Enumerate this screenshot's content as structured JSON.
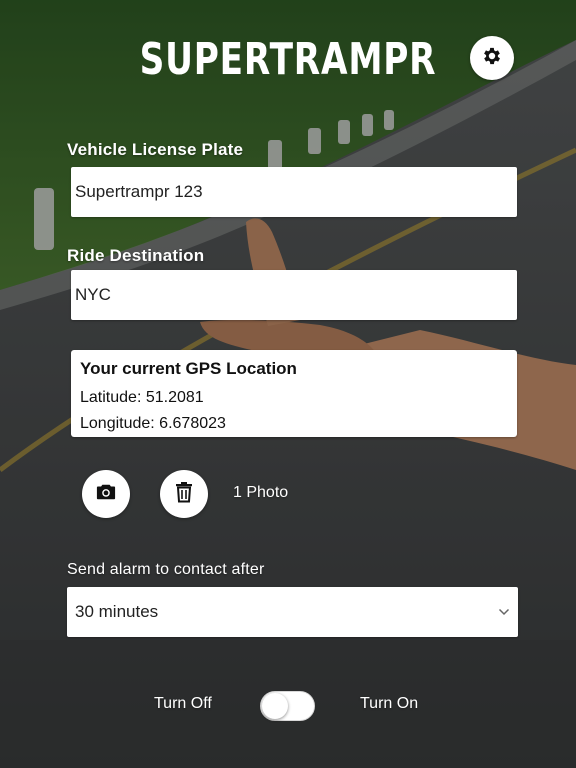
{
  "app": {
    "title": "SUPERTRAMPR"
  },
  "icons": {
    "settings": "gear-icon",
    "camera": "camera-icon",
    "delete": "trash-icon",
    "select_arrow": "chevron-down-icon"
  },
  "form": {
    "plate": {
      "label": "Vehicle License Plate",
      "value": "Supertrampr 123"
    },
    "destination": {
      "label": "Ride Destination",
      "value": "NYC"
    },
    "gps": {
      "title": "Your current GPS Location",
      "latitude_text": "Latitude: 51.2081",
      "longitude_text": "Longitude: 6.678023"
    },
    "photos": {
      "count_text": "1 Photo"
    },
    "alarm": {
      "label": "Send alarm to contact after",
      "selected": "30 minutes"
    },
    "toggle": {
      "off_label": "Turn Off",
      "on_label": "Turn On",
      "is_on": false
    }
  },
  "colors": {
    "text_on_background": "#ffffff",
    "field_background": "#ffffff",
    "icon": "#111111"
  }
}
